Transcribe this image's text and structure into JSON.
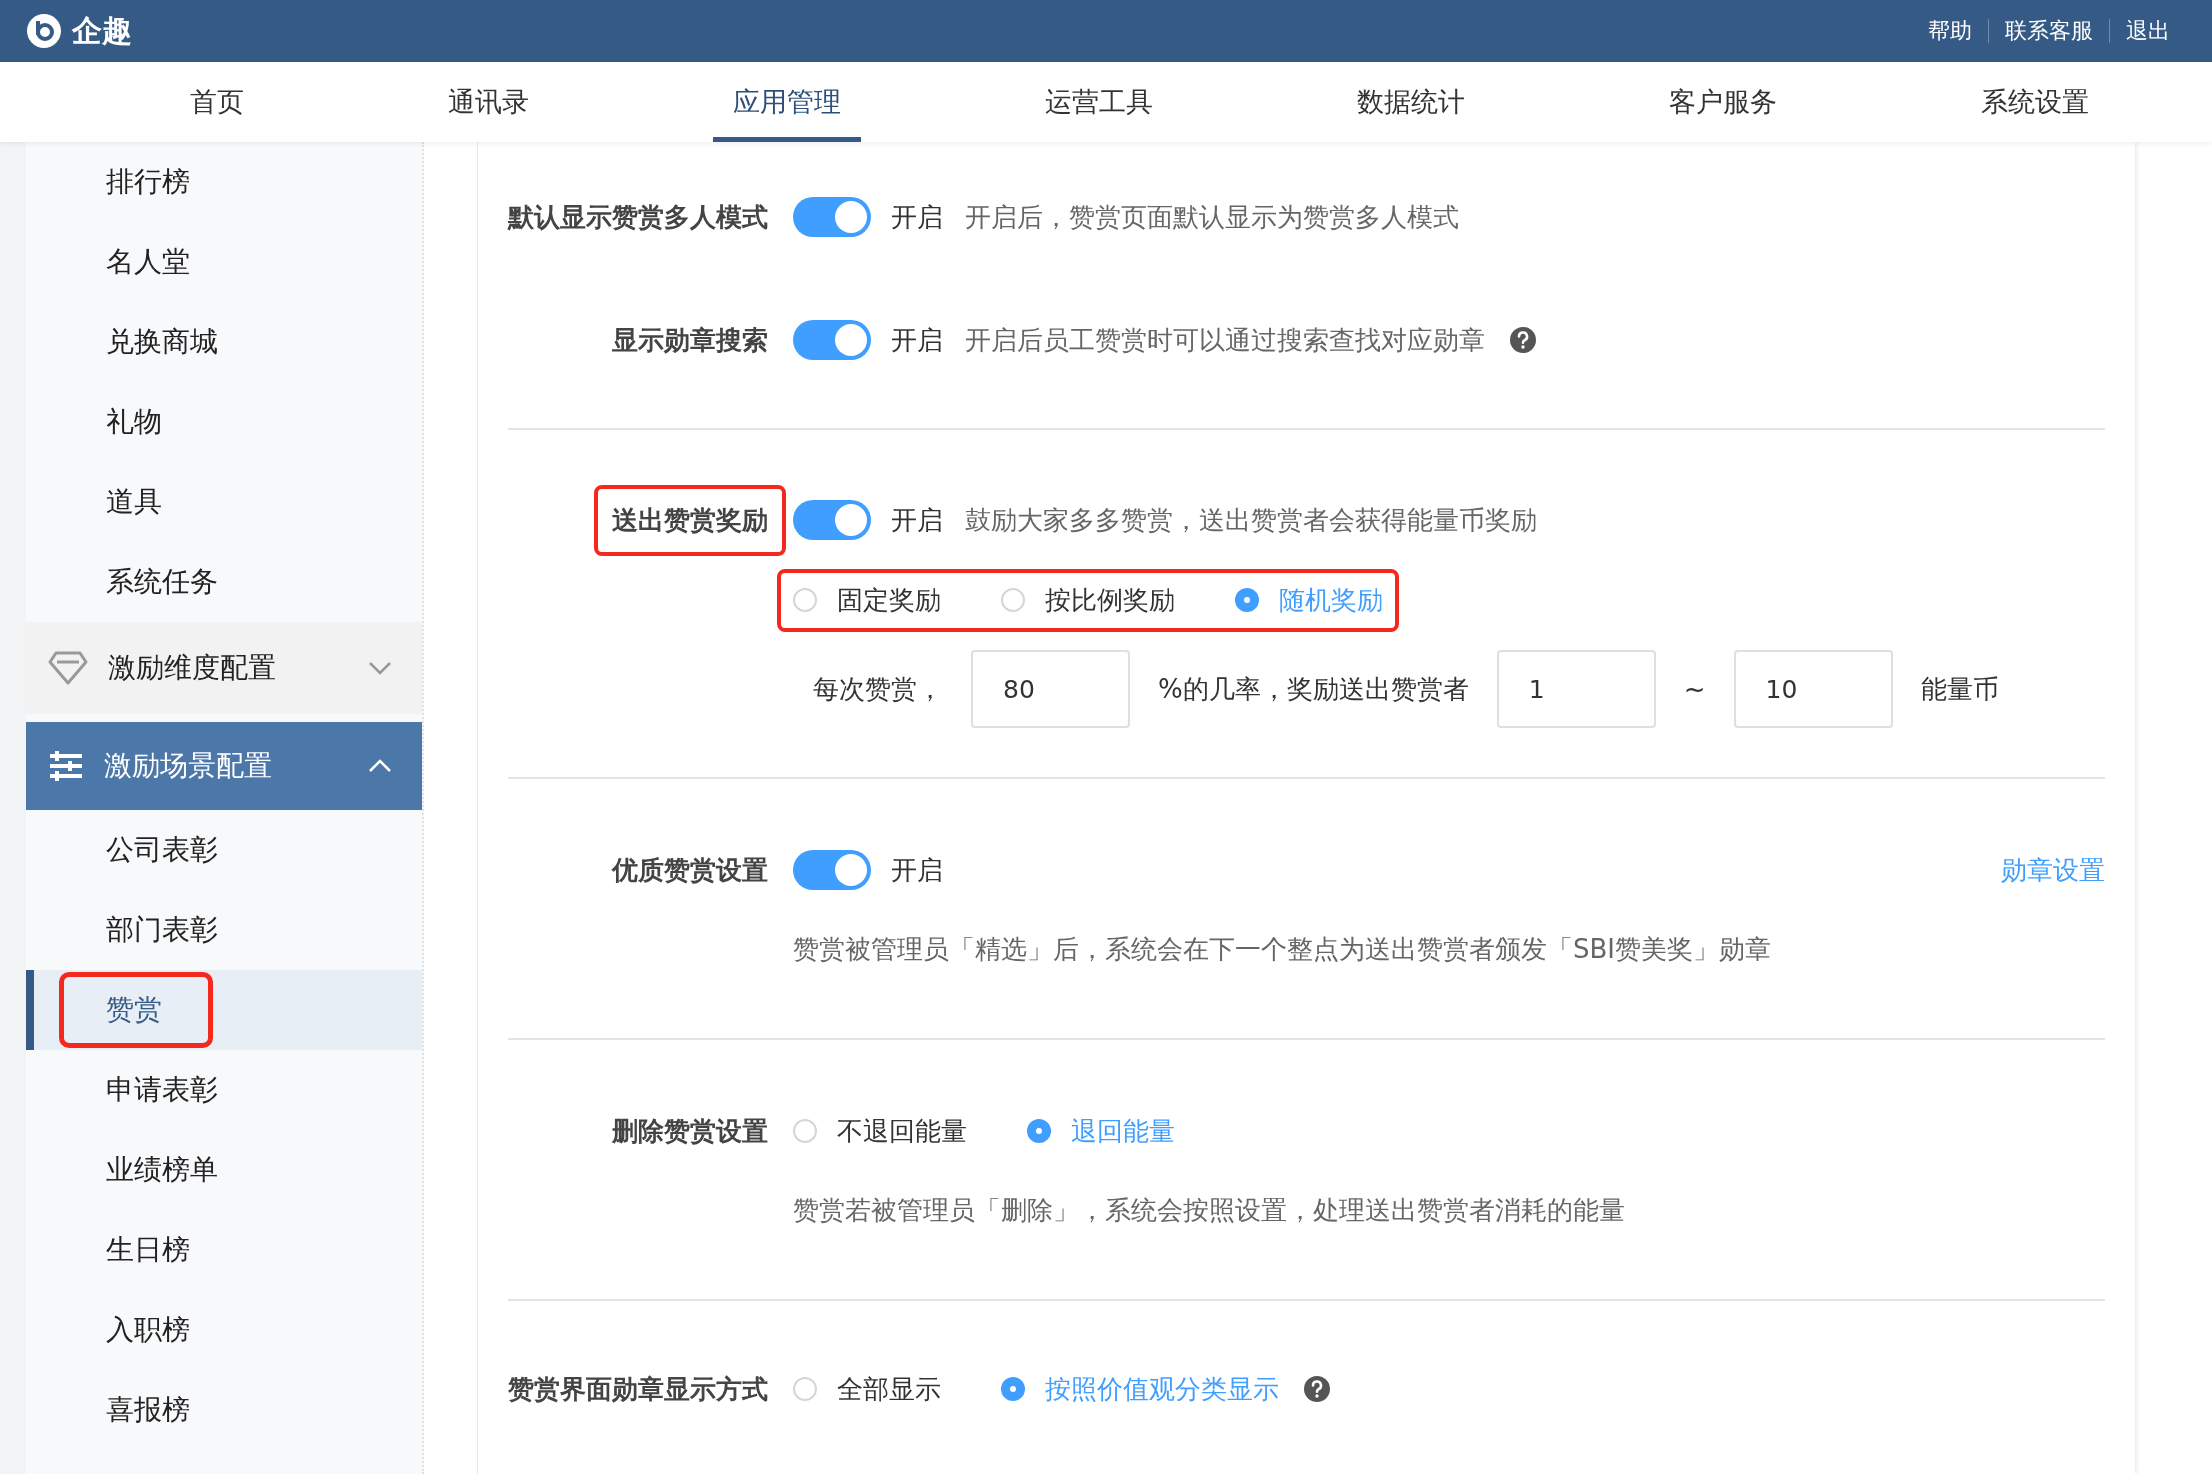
{
  "header": {
    "logo": "企趣",
    "links": [
      "帮助",
      "联系客服",
      "退出"
    ]
  },
  "tabs": [
    {
      "label": "首页",
      "selected": false
    },
    {
      "label": "通讯录",
      "selected": false
    },
    {
      "label": "应用管理",
      "selected": true
    },
    {
      "label": "运营工具",
      "selected": false
    },
    {
      "label": "数据统计",
      "selected": false
    },
    {
      "label": "客户服务",
      "selected": false
    },
    {
      "label": "系统设置",
      "selected": false
    }
  ],
  "sidebar": {
    "items": [
      {
        "kind": "item",
        "label": "排行榜",
        "selected": false,
        "highlighted": false
      },
      {
        "kind": "item",
        "label": "名人堂",
        "selected": false,
        "highlighted": false
      },
      {
        "kind": "item",
        "label": "兑换商城",
        "selected": false,
        "highlighted": false
      },
      {
        "kind": "item",
        "label": "礼物",
        "selected": false,
        "highlighted": false
      },
      {
        "kind": "item",
        "label": "道具",
        "selected": false,
        "highlighted": false
      },
      {
        "kind": "item",
        "label": "系统任务",
        "selected": false,
        "highlighted": false
      },
      {
        "kind": "group",
        "label": "激励维度配置",
        "expanded": false
      },
      {
        "kind": "group",
        "label": "激励场景配置",
        "expanded": true,
        "children": [
          {
            "label": "公司表彰",
            "selected": false,
            "highlighted": false
          },
          {
            "label": "部门表彰",
            "selected": false,
            "highlighted": false
          },
          {
            "label": "赞赏",
            "selected": true,
            "highlighted": true
          },
          {
            "label": "申请表彰",
            "selected": false,
            "highlighted": false
          },
          {
            "label": "业绩榜单",
            "selected": false,
            "highlighted": false
          },
          {
            "label": "生日榜",
            "selected": false,
            "highlighted": false
          },
          {
            "label": "入职榜",
            "selected": false,
            "highlighted": false
          },
          {
            "label": "喜报榜",
            "selected": false,
            "highlighted": false
          }
        ]
      }
    ]
  },
  "settings": {
    "groups": [
      [
        {
          "label": "默认显示赞赏多人模式",
          "highlighted": false,
          "control": {
            "kind": "toggle",
            "on": true,
            "text": "开启"
          },
          "note": "开启后，赞赏页面默认显示为赞赏多人模式"
        },
        {
          "label": "显示勋章搜索",
          "highlighted": false,
          "control": {
            "kind": "toggle",
            "on": true,
            "text": "开启"
          },
          "note": "开启后员工赞赏时可以通过搜索查找对应勋章",
          "help": true
        }
      ],
      [
        {
          "label": "送出赞赏奖励",
          "highlighted": true,
          "control": {
            "kind": "toggle",
            "on": true,
            "text": "开启"
          },
          "note": "鼓励大家多多赞赏，送出赞赏者会获得能量币奖励",
          "sub_options": {
            "highlighted": true,
            "options": [
              {
                "label": "固定奖励",
                "selected": false
              },
              {
                "label": "按比例奖励",
                "selected": false
              },
              {
                "label": "随机奖励",
                "selected": true
              }
            ]
          },
          "rule": [
            {
              "kind": "text",
              "text": "每次赞赏，"
            },
            {
              "kind": "input",
              "value": "80"
            },
            {
              "kind": "text",
              "text": "%的几率，奖励送出赞赏者"
            },
            {
              "kind": "input",
              "value": "1"
            },
            {
              "kind": "text",
              "text": "~"
            },
            {
              "kind": "input",
              "value": "10"
            },
            {
              "kind": "text",
              "text": "能量币"
            }
          ]
        }
      ],
      [
        {
          "label": "优质赞赏设置",
          "highlighted": false,
          "control": {
            "kind": "toggle",
            "on": true,
            "text": "开启"
          },
          "link": "勋章设置",
          "description": "赞赏被管理员「精选」后，系统会在下一个整点为送出赞赏者颁发「SBI赞美奖」勋章"
        }
      ],
      [
        {
          "label": "删除赞赏设置",
          "highlighted": false,
          "control": {
            "kind": "radio",
            "options": [
              {
                "label": "不退回能量",
                "selected": false
              },
              {
                "label": "退回能量",
                "selected": true
              }
            ]
          },
          "description": "赞赏若被管理员「删除」，系统会按照设置，处理送出赞赏者消耗的能量"
        }
      ],
      [
        {
          "label": "赞赏界面勋章显示方式",
          "highlighted": false,
          "control": {
            "kind": "radio",
            "options": [
              {
                "label": "全部显示",
                "selected": false
              },
              {
                "label": "按照价值观分类显示",
                "selected": true
              }
            ]
          },
          "help": true
        }
      ]
    ]
  }
}
